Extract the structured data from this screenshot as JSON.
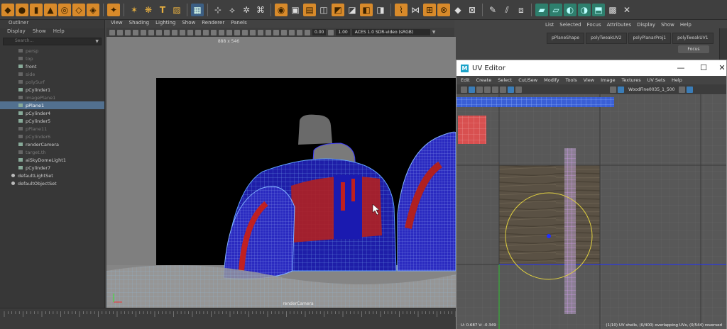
{
  "shelf": {
    "tools": [
      {
        "icon": "cube-icon",
        "glyph": "◆",
        "style": "o"
      },
      {
        "icon": "sphere-icon",
        "glyph": "●",
        "style": "o"
      },
      {
        "icon": "cylinder-icon",
        "glyph": "▮",
        "style": "o"
      },
      {
        "icon": "cone-icon",
        "glyph": "▲",
        "style": "o"
      },
      {
        "icon": "torus-icon",
        "glyph": "◎",
        "style": "o"
      },
      {
        "icon": "plane-icon",
        "glyph": "◇",
        "style": "o"
      },
      {
        "icon": "pipe-icon",
        "glyph": "◈",
        "style": "o"
      },
      {
        "icon": "sep"
      },
      {
        "icon": "platonic-icon",
        "glyph": "✦",
        "style": "o"
      },
      {
        "icon": "sep"
      },
      {
        "icon": "curve-tool-icon",
        "glyph": "✶",
        "style": "t"
      },
      {
        "icon": "ep-curve-icon",
        "glyph": "❋",
        "style": "t"
      },
      {
        "icon": "text-tool-icon",
        "glyph": "T",
        "style": "t"
      },
      {
        "icon": "svg-tool-icon",
        "glyph": "▨",
        "style": "t"
      },
      {
        "icon": "sep"
      },
      {
        "icon": "grid-tool-icon",
        "glyph": "▦",
        "style": "b"
      },
      {
        "icon": "sep"
      },
      {
        "icon": "joint-icon",
        "glyph": "⊹",
        "style": "w"
      },
      {
        "icon": "ik-handle-icon",
        "glyph": "⟡",
        "style": "w"
      },
      {
        "icon": "skin-icon",
        "glyph": "✲",
        "style": "w"
      },
      {
        "icon": "bind-icon",
        "glyph": "⌘",
        "style": "w"
      },
      {
        "icon": "sep"
      },
      {
        "icon": "smooth-icon",
        "glyph": "◉",
        "style": "o"
      },
      {
        "icon": "combine-icon",
        "glyph": "▣",
        "style": "w"
      },
      {
        "icon": "separate-icon",
        "glyph": "▤",
        "style": "o"
      },
      {
        "icon": "extract-icon",
        "glyph": "◫",
        "style": "w"
      },
      {
        "icon": "bevel-icon",
        "glyph": "◩",
        "style": "o"
      },
      {
        "icon": "bridge-icon",
        "glyph": "◪",
        "style": "w"
      },
      {
        "icon": "extrude-icon",
        "glyph": "◧",
        "style": "o"
      },
      {
        "icon": "boolean-icon",
        "glyph": "◨",
        "style": "w"
      },
      {
        "icon": "sep"
      },
      {
        "icon": "multi-cut-icon",
        "glyph": "⌇",
        "style": "o"
      },
      {
        "icon": "target-weld-icon",
        "glyph": "⋈",
        "style": "w"
      },
      {
        "icon": "connect-icon",
        "glyph": "⊞",
        "style": "o"
      },
      {
        "icon": "merge-icon",
        "glyph": "⊗",
        "style": "o"
      },
      {
        "icon": "collapse-icon",
        "glyph": "◆",
        "style": "w"
      },
      {
        "icon": "fill-hole-icon",
        "glyph": "⊠",
        "style": "w"
      },
      {
        "icon": "sep"
      },
      {
        "icon": "draw-icon",
        "glyph": "✎",
        "style": "w"
      },
      {
        "icon": "slice-icon",
        "glyph": "⫽",
        "style": "w"
      },
      {
        "icon": "mirror-icon",
        "glyph": "⧈",
        "style": "w"
      },
      {
        "icon": "sep"
      },
      {
        "icon": "uv-planar-icon",
        "glyph": "▰",
        "style": "g"
      },
      {
        "icon": "uv-cylindrical-icon",
        "glyph": "▱",
        "style": "g"
      },
      {
        "icon": "uv-spherical-icon",
        "glyph": "◐",
        "style": "g"
      },
      {
        "icon": "uv-auto-icon",
        "glyph": "◑",
        "style": "g"
      },
      {
        "icon": "uv-unfold-icon",
        "glyph": "⬒",
        "style": "g"
      },
      {
        "icon": "uv-checker-icon",
        "glyph": "▩",
        "style": "w"
      },
      {
        "icon": "uv-cut-icon",
        "glyph": "✕",
        "style": "w"
      }
    ]
  },
  "outliner": {
    "title": "Outliner",
    "menu": [
      "Display",
      "Show",
      "Help"
    ],
    "search_placeholder": "Search...",
    "items": [
      {
        "label": "persp",
        "state": "dim"
      },
      {
        "label": "top",
        "state": "dim"
      },
      {
        "label": "front",
        "state": "normal"
      },
      {
        "label": "side",
        "state": "dim"
      },
      {
        "label": "polySurf",
        "state": "dim"
      },
      {
        "label": "pCylinder1",
        "state": "normal"
      },
      {
        "label": "imagePlane1",
        "state": "dim"
      },
      {
        "label": "pPlane1",
        "state": "sel"
      },
      {
        "label": "pCylinder4",
        "state": "normal"
      },
      {
        "label": "pCylinder5",
        "state": "normal"
      },
      {
        "label": "pPlane11",
        "state": "dim"
      },
      {
        "label": "pCylinder6",
        "state": "dim"
      },
      {
        "label": "renderCamera",
        "state": "normal"
      },
      {
        "label": "target.th",
        "state": "dim"
      },
      {
        "label": "aiSkyDomeLight1",
        "state": "normal"
      },
      {
        "label": "pCylinder7",
        "state": "normal"
      },
      {
        "label": "defaultLightSet",
        "state": "set"
      },
      {
        "label": "defaultObjectSet",
        "state": "set"
      }
    ]
  },
  "viewport": {
    "menu": [
      "View",
      "Shading",
      "Lighting",
      "Show",
      "Renderer",
      "Panels"
    ],
    "exposure": "0.00",
    "gamma": "1.00",
    "color_space": "ACES 1.0 SDR-video (sRGB)",
    "resolution": "888 x 546",
    "camera_label": "renderCamera"
  },
  "attribute_editor": {
    "menu": [
      "List",
      "Selected",
      "Focus",
      "Attributes",
      "Display",
      "Show",
      "Help"
    ],
    "tabs": [
      "pPlaneShape",
      "polyTweakUV2",
      "polyPlanarProj1",
      "polyTweakUV1"
    ],
    "focus_label": "Focus"
  },
  "uv_editor": {
    "title": "UV Editor",
    "menu": [
      "Edit",
      "Create",
      "Select",
      "Cut/Sew",
      "Modify",
      "Tools",
      "View",
      "Image",
      "Textures",
      "UV Sets",
      "Help"
    ],
    "texture_name": "WoodFine0035_1_500",
    "uv_readout": "U: 0.687  V: -0.349",
    "status": "(1/10) UV shells, (0/400) overlapping UVs, (0/544) reversed"
  },
  "window_controls": {
    "minimize": "—",
    "maximize": "☐",
    "close": "✕"
  }
}
